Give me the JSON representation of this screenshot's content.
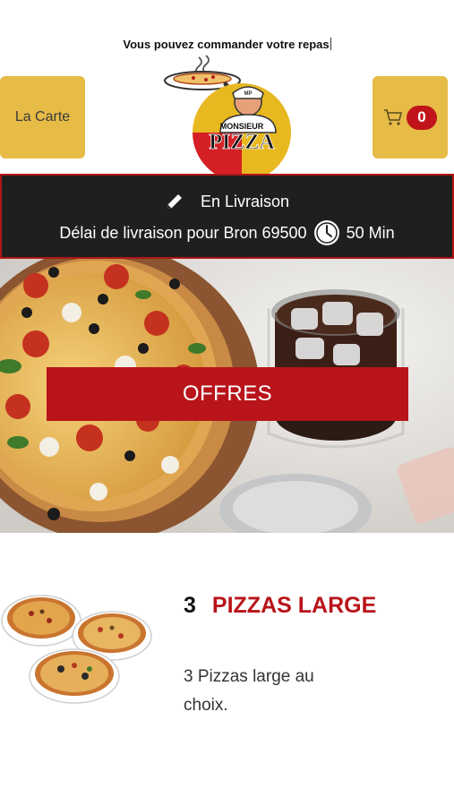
{
  "header": {
    "message": "Vous pouvez commander votre repas",
    "menu_button_label": "La Carte",
    "cart_count": "0",
    "logo": {
      "text_top": "MONSIEUR",
      "text_main": "PIZZA",
      "cap_text": "MP"
    },
    "colors": {
      "button_bg": "#e6bb46",
      "badge_bg": "#c0141a"
    }
  },
  "delivery": {
    "mode": "En Livraison",
    "delay_text": "Délai de livraison pour Bron 69500",
    "time": "50 Min",
    "icons": [
      "pencil-icon",
      "clock-icon"
    ]
  },
  "hero": {
    "offers_button": "OFFRES",
    "colors": {
      "button_bg": "#b8141a"
    }
  },
  "product": {
    "quantity": "3",
    "name": "PIZZAS LARGE",
    "description": "3 Pizzas large au choix."
  }
}
